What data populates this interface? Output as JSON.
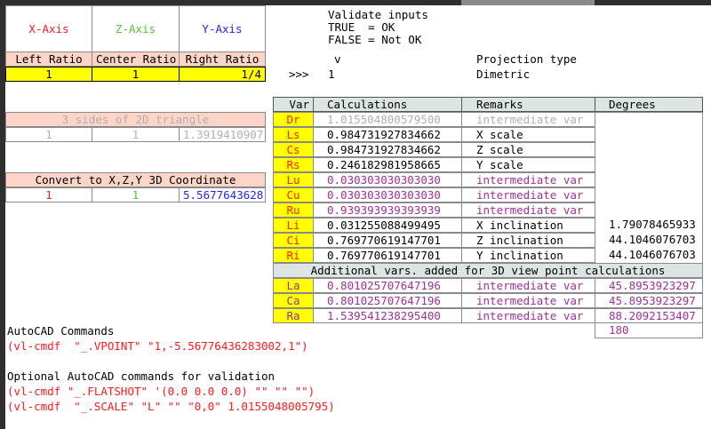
{
  "axes": {
    "x": "X-Axis",
    "z": "Z-Axis",
    "y": "Y-Axis"
  },
  "ratios": {
    "left_label": "Left Ratio",
    "center_label": "Center Ratio",
    "right_label": "Right Ratio",
    "left": "1",
    "center": "1",
    "right": "1/4"
  },
  "triangle": {
    "title": "3 sides of 2D triangle",
    "a": "1",
    "b": "1",
    "c": "1.3919410907"
  },
  "convert": {
    "title": "Convert to X,Z,Y 3D Coordinate",
    "x": "1",
    "z": "1",
    "y": "5.5677643628"
  },
  "validate": {
    "line1": "Validate inputs",
    "line2": "TRUE  = OK",
    "line3": "FALSE = Not OK",
    "marker": "v",
    "arrow": ">>>",
    "value": "1"
  },
  "projection": {
    "label": "Projection type",
    "value": "Dimetric"
  },
  "table": {
    "headers": {
      "var": "Var",
      "calc": "Calculations",
      "remarks": "Remarks",
      "degrees": "Degrees"
    },
    "rows": [
      {
        "var": "Dr",
        "calc": "1.015504800579500",
        "remark": "intermediate var",
        "deg": "",
        "style": "lg"
      },
      {
        "var": "Ls",
        "calc": "0.984731927834662",
        "remark": "X scale",
        "deg": "",
        "style": ""
      },
      {
        "var": "Cs",
        "calc": "0.984731927834662",
        "remark": "Z scale",
        "deg": "",
        "style": ""
      },
      {
        "var": "Rs",
        "calc": "0.246182981958665",
        "remark": "Y scale",
        "deg": "",
        "style": ""
      },
      {
        "var": "Lu",
        "calc": "0.030303030303030",
        "remark": "intermediate var",
        "deg": "",
        "style": "pur"
      },
      {
        "var": "Cu",
        "calc": "0.030303030303030",
        "remark": "intermediate var",
        "deg": "",
        "style": "pur"
      },
      {
        "var": "Ru",
        "calc": "0.939393939393939",
        "remark": "intermediate var",
        "deg": "",
        "style": "pur"
      },
      {
        "var": "Li",
        "calc": "0.031255088499495",
        "remark": "X inclination",
        "deg": "1.79078465933",
        "style": ""
      },
      {
        "var": "Ci",
        "calc": "0.769770619147701",
        "remark": "Z inclination",
        "deg": "44.1046076703",
        "style": ""
      },
      {
        "var": "Ri",
        "calc": "0.769770619147701",
        "remark": "Y inclination",
        "deg": "44.1046076703",
        "style": ""
      }
    ],
    "additional_title": "Additional vars. added for 3D view point calculations",
    "rows2": [
      {
        "var": "La",
        "calc": "0.801025707647196",
        "remark": "intermediate var",
        "deg": "45.8953923297"
      },
      {
        "var": "Ca",
        "calc": "0.801025707647196",
        "remark": "intermediate var",
        "deg": "45.8953923297"
      },
      {
        "var": "Ra",
        "calc": "1.539541238295400",
        "remark": "intermediate var",
        "deg": "88.2092153407"
      }
    ],
    "total_deg": "180"
  },
  "commands": {
    "title": "AutoCAD Commands",
    "vpoint": "(vl-cmdf  \"_.VPOINT\" \"1,-5.56776436283002,1\")",
    "optional_title": "Optional AutoCAD commands for validation",
    "flatshot": "(vl-cmdf \"_.FLATSHOT\" '(0.0 0.0 0.0) \"\" \"\" \"\")",
    "scale": "(vl-cmdf  \"_.SCALE\" \"L\" \"\" \"0,0\" 1.0155048005795)"
  }
}
